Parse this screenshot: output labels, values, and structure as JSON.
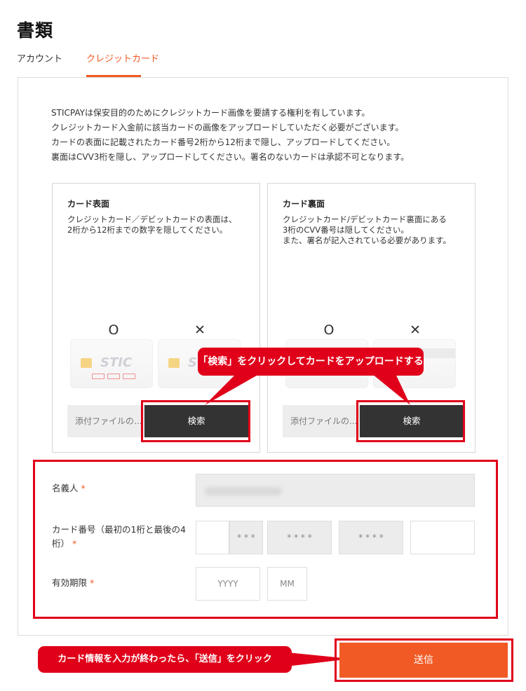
{
  "page": {
    "title": "書類"
  },
  "tabs": [
    {
      "label": "アカウント",
      "active": false
    },
    {
      "label": "クレジットカード",
      "active": true
    }
  ],
  "notice": [
    "STICPAYは保安目的のためにクレジットカード画像を要請する権利を有しています。",
    "クレジットカード入金前に該当カードの画像をアップロードしていただく必要がございます。",
    "カードの表面に記載されたカード番号2桁から12桁まで隠し、アップロードしてください。",
    "裏面はCVV3桁を隠し、アップロードしてください。署名のないカードは承認不可となります。"
  ],
  "card_front": {
    "title": "カード表面",
    "desc": [
      "クレジットカード／デビットカードの表面は、",
      "2桁から12桁までの数字を隠してください。"
    ],
    "ok_mark": "O",
    "ng_mark": "✕",
    "brand": "STIC",
    "file_placeholder": "添付ファイルの...",
    "search_label": "検索"
  },
  "card_back": {
    "title": "カード裏面",
    "desc": [
      "クレジットカード/デビットカード裏面にある",
      "3桁のCVV番号は隠してください。",
      "また、署名が記入されている必要があります。"
    ],
    "ok_mark": "O",
    "ng_mark": "✕",
    "file_placeholder": "添付ファイルの...",
    "search_label": "検索"
  },
  "callouts": {
    "upload": "「検索」をクリックしてカードをアップロードする",
    "submit": "カード情報を入力が終わったら、「送信」をクリック"
  },
  "form": {
    "name_label": "名義人",
    "required_mark": "*",
    "card_number_label_line1": "カード番号（最初の1桁と最後の4",
    "card_number_label_line2": "桁）",
    "card_number_masks": [
      "* * *",
      "* * * *",
      "* * * *"
    ],
    "expiry_label": "有効期限",
    "expiry_year_placeholder": "YYYY",
    "expiry_month_placeholder": "MM"
  },
  "submit_label": "送信",
  "colors": {
    "accent": "#f05a24",
    "annotation_red": "#e0001a",
    "dark_button": "#333333"
  }
}
